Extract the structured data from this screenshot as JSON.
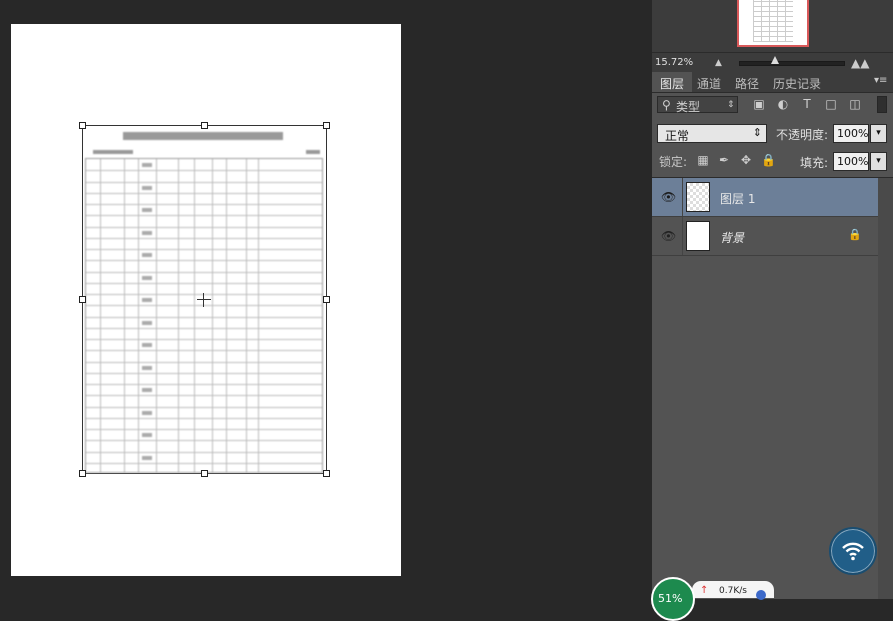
{
  "navigator": {
    "zoom": "15.72%",
    "zoom_level_fraction": 0.35
  },
  "panel_tabs": [
    "图层",
    "通道",
    "路径",
    "历史记录"
  ],
  "filter": {
    "kind_label": "类型",
    "icons": [
      "image-filter-icon",
      "adjustment-filter-icon",
      "type-filter-icon",
      "shape-filter-icon",
      "smart-object-filter-icon"
    ]
  },
  "blend": {
    "mode": "正常",
    "opacity_label": "不透明度:",
    "opacity_value": "100%"
  },
  "lock": {
    "label": "锁定:",
    "fill_label": "填充:",
    "fill_value": "100%"
  },
  "layers": [
    {
      "name": "图层 1",
      "selected": true,
      "locked": false
    },
    {
      "name": "背景",
      "selected": false,
      "locked": true
    }
  ],
  "tray": {
    "cpu": "51%",
    "upload_rate": "0.7K/s"
  },
  "colors": {
    "canvas_bg": "#282828",
    "panel_bg": "#535353",
    "selected_layer": "#6c7f98",
    "navigator_frame": "#d9595a",
    "wifi_button": "#215e88"
  }
}
